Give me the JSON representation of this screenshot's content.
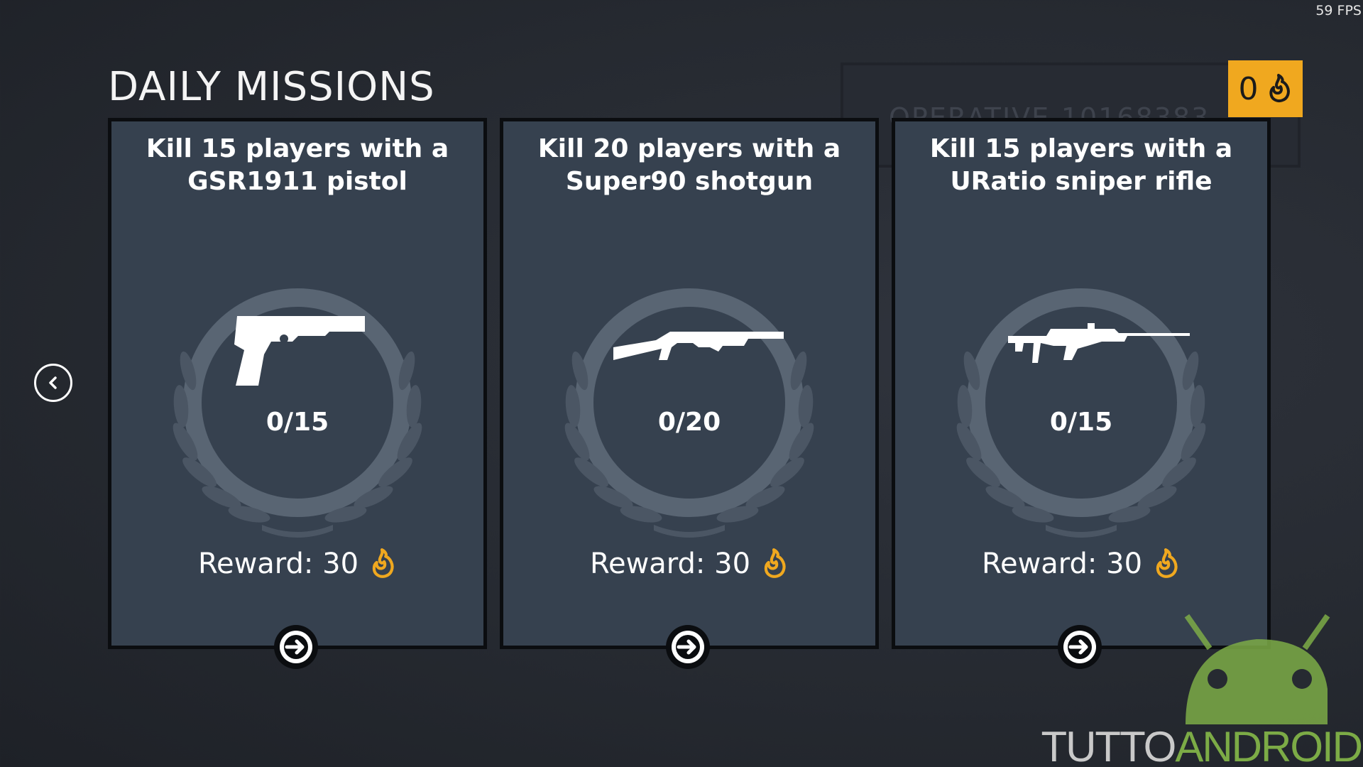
{
  "hud": {
    "fps": "59 FPS"
  },
  "header": {
    "title": "DAILY MISSIONS"
  },
  "profile": {
    "name": "OPERATIVE-10168383"
  },
  "currency": {
    "amount": "0",
    "icon": "flame-coin-icon",
    "color": "#f0a81f"
  },
  "navigation": {
    "back_icon": "chevron-left-icon"
  },
  "missions": [
    {
      "title": "Kill 15 players with a GSR1911 pistol",
      "weapon_icon": "pistol-icon",
      "progress": "0/15",
      "reward_label": "Reward: 30",
      "reward_icon": "flame-coin-icon"
    },
    {
      "title": "Kill 20 players with a Super90 shotgun",
      "weapon_icon": "shotgun-icon",
      "progress": "0/20",
      "reward_label": "Reward: 30",
      "reward_icon": "flame-coin-icon"
    },
    {
      "title": "Kill 15 players with a URatio sniper rifle",
      "weapon_icon": "sniper-rifle-icon",
      "progress": "0/15",
      "reward_label": "Reward: 30",
      "reward_icon": "flame-coin-icon"
    }
  ],
  "watermark": {
    "part1": "TUTTO",
    "part2": "ANDROID"
  },
  "colors": {
    "card": "#36414f",
    "accent": "#f0a81f",
    "background": "#262a31"
  }
}
